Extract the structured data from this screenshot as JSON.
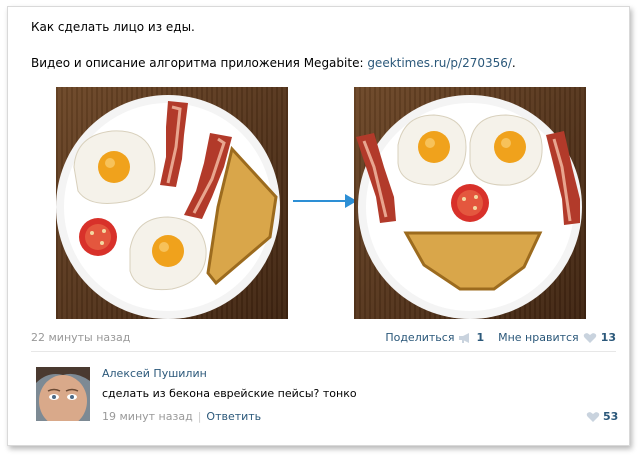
{
  "post": {
    "title": "Как сделать лицо из еды.",
    "desc_prefix": "Видео и описание алгоритма приложения Megabite: ",
    "link": "geektimes.ru/p/270356/",
    "desc_suffix": "."
  },
  "footer": {
    "timestamp": "22 минуты назад",
    "share_label": "Поделиться",
    "share_count": "1",
    "like_label": "Мне нравится",
    "like_count": "13"
  },
  "comment": {
    "author": "Алексей Пушилин",
    "text": "сделать из бекона еврейские пейсы? тонко",
    "timestamp": "19 минут назад",
    "separator": "|",
    "reply_label": "Ответить",
    "like_count": "53"
  },
  "colors": {
    "link": "#2b587a",
    "arrow": "#2d8fd5",
    "muted": "#999999"
  },
  "icons": [
    "megaphone-icon",
    "heart-icon",
    "arrow-right-icon"
  ]
}
